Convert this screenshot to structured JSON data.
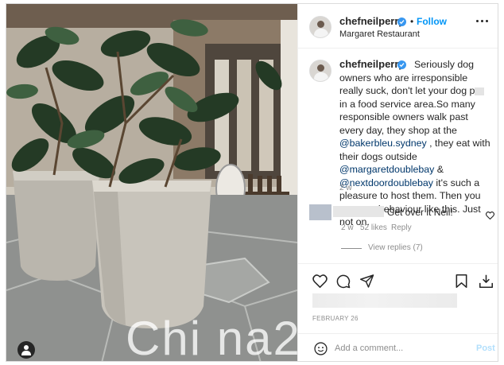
{
  "post": {
    "username": "chefneilperry",
    "location": "Margaret Restaurant",
    "follow_separator": "•",
    "follow_label": "Follow",
    "caption_parts": [
      "Seriously dog owners who are irresponsible really suck, don't let your dog p",
      " in a food service area.So many responsible owners walk past every day, they shop at the ",
      "@bakerbleu.sydney",
      " , they eat with their dogs outside ",
      "@margaretdoublebay",
      " & ",
      "@nextdoordoublebay",
      " it's such a pleasure to host them. Then you get poor behaviour like this. Just not on."
    ],
    "caption_time": "2 w",
    "date": "FEBRUARY 26"
  },
  "comment": {
    "text": "Get over it Neil!",
    "time": "2 w",
    "likes": "52 likes",
    "reply_label": "Reply",
    "view_replies": "View replies (7)"
  },
  "add_comment": {
    "placeholder": "Add a comment...",
    "post_label": "Post"
  },
  "watermark": "Chi na2",
  "icons": [
    "more-icon",
    "verified-icon",
    "heart-icon",
    "comment-icon",
    "share-icon",
    "bookmark-icon",
    "download-icon",
    "emoji-icon",
    "user-tag-icon"
  ],
  "colors": {
    "accent": "#0095f6",
    "text": "#262626",
    "muted": "#8e8e8e",
    "post_disabled": "#b2dffc"
  }
}
